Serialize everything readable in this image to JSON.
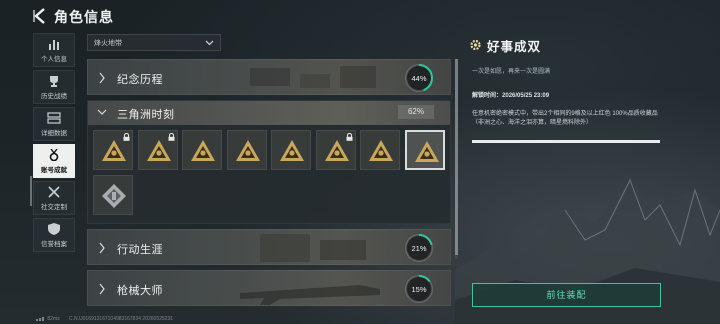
{
  "header": {
    "title": "角色信息"
  },
  "sidebar": {
    "items": [
      {
        "label": "个人信息",
        "icon": "bar-chart-icon",
        "active": false
      },
      {
        "label": "历史战绩",
        "icon": "trophy-icon",
        "active": false
      },
      {
        "label": "详细数据",
        "icon": "data-panels-icon",
        "active": false
      },
      {
        "label": "账号成就",
        "icon": "medal-icon",
        "active": true
      },
      {
        "label": "社交定制",
        "icon": "tools-icon",
        "active": false
      },
      {
        "label": "信誉档案",
        "icon": "shield-icon",
        "active": false
      }
    ]
  },
  "filter": {
    "selected": "烽火地带"
  },
  "categories": [
    {
      "name": "纪念历程",
      "progress_text": "44%",
      "progress": 0.44
    },
    {
      "name": "三角洲时刻",
      "progress_text": "62%",
      "progress": 0.62,
      "expanded": true,
      "badges": [
        {
          "icon": "badge-emblem-icon",
          "locked": true,
          "selected": false
        },
        {
          "icon": "badge-emblem-icon",
          "locked": true,
          "selected": false
        },
        {
          "icon": "badge-emblem-icon",
          "locked": false,
          "selected": false
        },
        {
          "icon": "badge-emblem-icon",
          "locked": false,
          "selected": false
        },
        {
          "icon": "badge-emblem-icon",
          "locked": false,
          "selected": false
        },
        {
          "icon": "badge-emblem-icon",
          "locked": true,
          "selected": false
        },
        {
          "icon": "badge-emblem-icon",
          "locked": false,
          "selected": false
        },
        {
          "icon": "badge-emblem-icon",
          "locked": false,
          "selected": true
        },
        {
          "icon": "badge-emblem-grey-icon",
          "locked": false,
          "selected": false
        }
      ]
    },
    {
      "name": "行动生涯",
      "progress_text": "21%",
      "progress": 0.21
    },
    {
      "name": "枪械大师",
      "progress_text": "15%",
      "progress": 0.15
    }
  ],
  "detail": {
    "title": "好事成双",
    "subtitle": "一次是如愿，再来一次是圆满",
    "unlock_label": "解锁时间：",
    "unlock_time": "2026/05/25 23:09",
    "description": "任意机密绝密模式中，带出2个相同的9格及以上红色 100%品质收藏品（非洲之心、海洋之泪亦算，暗星燃料除外）",
    "progress": 1.0,
    "equip_button": "前往装配"
  },
  "colors": {
    "accent": "#3ec4a4",
    "gold": "#c9a75a",
    "ring": "#2fc79a"
  },
  "footer": {
    "ping": "82ms",
    "build": "C.N.U016913167104983167834 20260525231"
  }
}
